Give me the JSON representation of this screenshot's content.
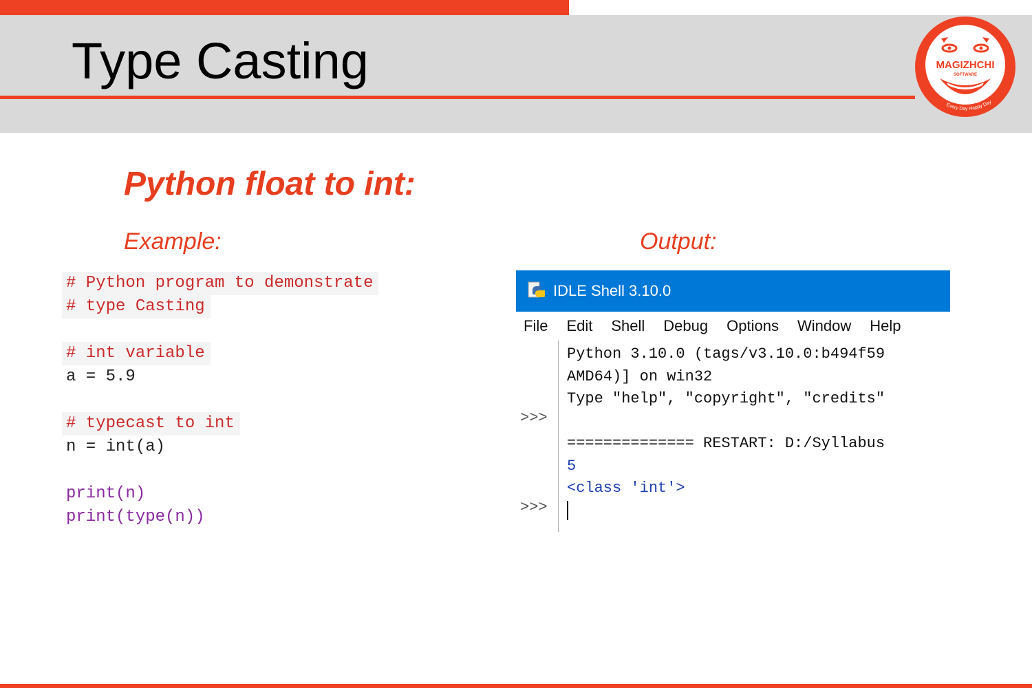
{
  "slide": {
    "title": "Type Casting",
    "subtitle": "Python float to int:",
    "example_label": "Example:",
    "output_label": "Output:"
  },
  "logo": {
    "name": "MAGIZHCHI",
    "sub": "SOFTWARE",
    "tagline": "Every Day Happy Day"
  },
  "code": {
    "lines": [
      "# Python program to demonstrate",
      "# type Casting",
      "",
      "# int variable",
      "a = 5.9",
      "",
      "# typecast to int",
      "n = int(a)",
      "",
      "print(n)",
      "print(type(n))"
    ]
  },
  "idle": {
    "title": "IDLE Shell 3.10.0",
    "menu": [
      "File",
      "Edit",
      "Shell",
      "Debug",
      "Options",
      "Window",
      "Help"
    ],
    "prompt": ">>>",
    "lines": [
      "Python 3.10.0 (tags/v3.10.0:b494f59",
      "AMD64)] on win32",
      "Type \"help\", \"copyright\", \"credits\"",
      "",
      "============== RESTART: D:/Syllabus",
      "5",
      "<class 'int'>"
    ]
  },
  "colors": {
    "accent": "#ee4123",
    "header_bg": "#d9d9d9",
    "idle_titlebar": "#0078d7"
  }
}
